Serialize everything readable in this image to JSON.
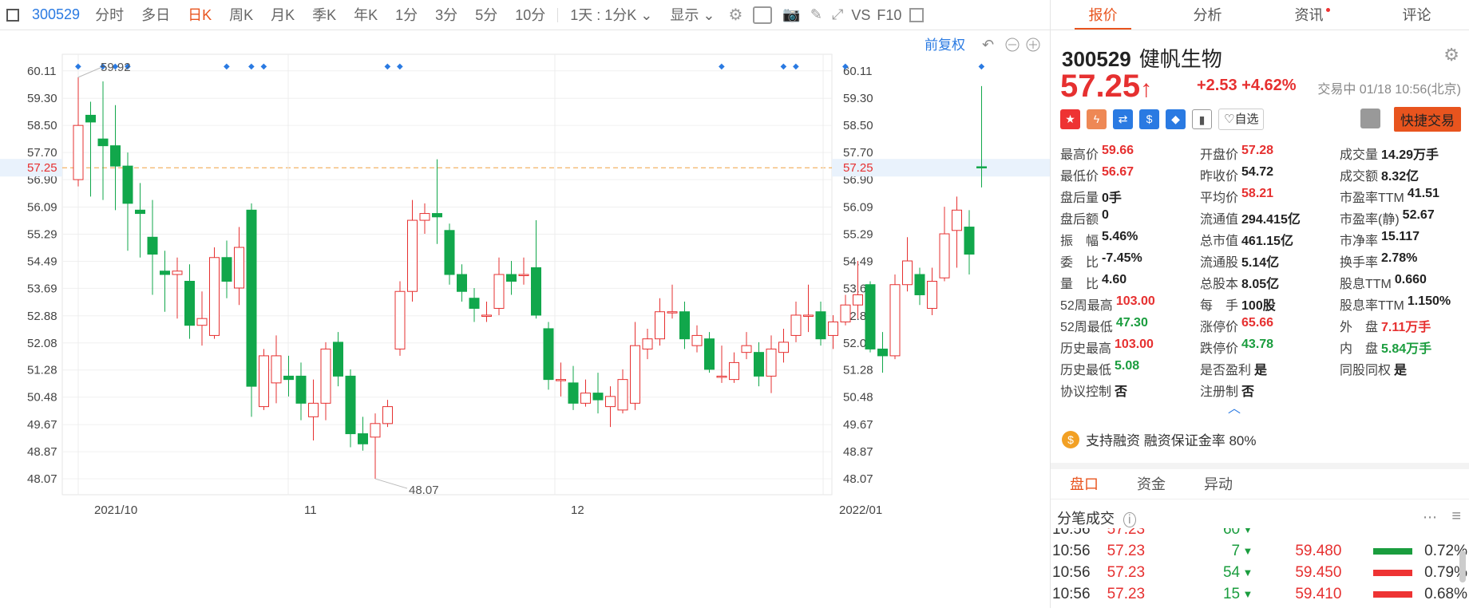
{
  "toolbar": {
    "items": [
      "300529",
      "分时",
      "多日",
      "日K",
      "周K",
      "月K",
      "季K",
      "年K",
      "1分",
      "3分",
      "5分",
      "10分",
      "1天 : 1分K",
      "显示",
      "VS",
      "F10"
    ],
    "active_index": 3
  },
  "chart": {
    "restore_label": "前复权",
    "high_label": "59.92",
    "low_label": "48.07",
    "current_label": "57.25",
    "y_ticks": [
      "60.11",
      "59.30",
      "58.50",
      "57.70",
      "57.25",
      "56.90",
      "56.09",
      "55.29",
      "54.49",
      "53.69",
      "52.88",
      "52.08",
      "51.28",
      "50.48",
      "49.67",
      "48.87",
      "48.07"
    ],
    "x_labels": [
      "2021/10",
      "11",
      "12",
      "2022/01"
    ]
  },
  "chart_data": {
    "type": "candlestick",
    "x_labels": [
      "2021/10",
      "11",
      "12",
      "2022/01"
    ],
    "ylim": [
      47.6,
      60.6
    ],
    "current_price": 57.25,
    "candles": [
      {
        "o": 56.9,
        "c": 58.5,
        "h": 59.92,
        "l": 56.7
      },
      {
        "o": 58.8,
        "c": 58.6,
        "h": 59.2,
        "l": 56.4
      },
      {
        "o": 58.1,
        "c": 57.9,
        "h": 59.8,
        "l": 56.3
      },
      {
        "o": 57.9,
        "c": 57.3,
        "h": 59.1,
        "l": 56.0
      },
      {
        "o": 57.3,
        "c": 56.2,
        "h": 57.7,
        "l": 54.8
      },
      {
        "o": 56.0,
        "c": 55.9,
        "h": 56.8,
        "l": 54.6
      },
      {
        "o": 55.2,
        "c": 54.7,
        "h": 56.3,
        "l": 53.5
      },
      {
        "o": 54.2,
        "c": 54.1,
        "h": 54.8,
        "l": 53.0
      },
      {
        "o": 54.1,
        "c": 54.2,
        "h": 54.6,
        "l": 52.8
      },
      {
        "o": 53.9,
        "c": 52.6,
        "h": 54.4,
        "l": 52.2
      },
      {
        "o": 52.6,
        "c": 52.8,
        "h": 53.6,
        "l": 52.0
      },
      {
        "o": 52.3,
        "c": 54.6,
        "h": 54.9,
        "l": 52.2
      },
      {
        "o": 54.6,
        "c": 53.9,
        "h": 55.1,
        "l": 53.4
      },
      {
        "o": 53.7,
        "c": 54.9,
        "h": 55.5,
        "l": 53.2
      },
      {
        "o": 56.0,
        "c": 50.8,
        "h": 56.2,
        "l": 49.9
      },
      {
        "o": 50.2,
        "c": 51.7,
        "h": 51.9,
        "l": 50.1
      },
      {
        "o": 50.9,
        "c": 51.7,
        "h": 52.3,
        "l": 50.3
      },
      {
        "o": 51.1,
        "c": 51.0,
        "h": 51.7,
        "l": 50.5
      },
      {
        "o": 51.1,
        "c": 50.3,
        "h": 51.5,
        "l": 49.8
      },
      {
        "o": 49.9,
        "c": 50.3,
        "h": 51.0,
        "l": 49.2
      },
      {
        "o": 50.3,
        "c": 51.9,
        "h": 52.1,
        "l": 49.8
      },
      {
        "o": 52.1,
        "c": 51.1,
        "h": 52.4,
        "l": 50.8
      },
      {
        "o": 51.1,
        "c": 49.4,
        "h": 51.3,
        "l": 49.0
      },
      {
        "o": 49.4,
        "c": 49.1,
        "h": 49.9,
        "l": 48.9
      },
      {
        "o": 49.3,
        "c": 49.7,
        "h": 50.0,
        "l": 48.07
      },
      {
        "o": 49.7,
        "c": 50.2,
        "h": 50.4,
        "l": 49.6
      },
      {
        "o": 51.9,
        "c": 53.6,
        "h": 53.9,
        "l": 51.7
      },
      {
        "o": 53.6,
        "c": 55.7,
        "h": 56.3,
        "l": 53.3
      },
      {
        "o": 55.7,
        "c": 55.9,
        "h": 56.2,
        "l": 55.3
      },
      {
        "o": 55.9,
        "c": 55.8,
        "h": 57.5,
        "l": 55.0
      },
      {
        "o": 55.4,
        "c": 54.1,
        "h": 55.6,
        "l": 53.8
      },
      {
        "o": 54.1,
        "c": 53.6,
        "h": 54.4,
        "l": 53.3
      },
      {
        "o": 53.4,
        "c": 53.1,
        "h": 53.7,
        "l": 52.7
      },
      {
        "o": 52.9,
        "c": 52.9,
        "h": 53.3,
        "l": 52.7
      },
      {
        "o": 53.1,
        "c": 54.1,
        "h": 54.6,
        "l": 52.9
      },
      {
        "o": 54.1,
        "c": 53.9,
        "h": 54.5,
        "l": 53.5
      },
      {
        "o": 54.1,
        "c": 54.1,
        "h": 54.6,
        "l": 53.8
      },
      {
        "o": 54.3,
        "c": 52.9,
        "h": 55.7,
        "l": 52.8
      },
      {
        "o": 52.5,
        "c": 51.0,
        "h": 52.7,
        "l": 50.7
      },
      {
        "o": 51.0,
        "c": 51.0,
        "h": 51.5,
        "l": 50.5
      },
      {
        "o": 50.9,
        "c": 50.3,
        "h": 51.4,
        "l": 50.1
      },
      {
        "o": 50.3,
        "c": 50.6,
        "h": 51.0,
        "l": 50.2
      },
      {
        "o": 50.6,
        "c": 50.4,
        "h": 51.2,
        "l": 50.0
      },
      {
        "o": 50.2,
        "c": 50.5,
        "h": 50.8,
        "l": 49.6
      },
      {
        "o": 50.1,
        "c": 51.0,
        "h": 51.3,
        "l": 50.0
      },
      {
        "o": 50.3,
        "c": 52.0,
        "h": 52.7,
        "l": 50.1
      },
      {
        "o": 51.9,
        "c": 52.2,
        "h": 52.5,
        "l": 51.6
      },
      {
        "o": 52.2,
        "c": 53.0,
        "h": 53.4,
        "l": 52.0
      },
      {
        "o": 53.0,
        "c": 53.0,
        "h": 53.8,
        "l": 52.8
      },
      {
        "o": 53.0,
        "c": 52.2,
        "h": 53.3,
        "l": 51.9
      },
      {
        "o": 52.0,
        "c": 52.3,
        "h": 52.6,
        "l": 51.8
      },
      {
        "o": 52.2,
        "c": 51.3,
        "h": 52.4,
        "l": 51.2
      },
      {
        "o": 51.1,
        "c": 51.1,
        "h": 52.0,
        "l": 50.9
      },
      {
        "o": 51.0,
        "c": 51.5,
        "h": 51.8,
        "l": 50.9
      },
      {
        "o": 51.8,
        "c": 52.0,
        "h": 52.4,
        "l": 51.6
      },
      {
        "o": 51.8,
        "c": 51.1,
        "h": 52.1,
        "l": 50.8
      },
      {
        "o": 51.1,
        "c": 51.9,
        "h": 52.3,
        "l": 50.6
      },
      {
        "o": 51.8,
        "c": 52.1,
        "h": 52.5,
        "l": 51.5
      },
      {
        "o": 52.3,
        "c": 52.9,
        "h": 53.3,
        "l": 52.1
      },
      {
        "o": 52.9,
        "c": 52.9,
        "h": 53.8,
        "l": 52.4
      },
      {
        "o": 53.0,
        "c": 52.2,
        "h": 53.3,
        "l": 52.0
      },
      {
        "o": 52.3,
        "c": 52.7,
        "h": 52.9,
        "l": 51.9
      },
      {
        "o": 52.7,
        "c": 53.2,
        "h": 53.5,
        "l": 52.6
      },
      {
        "o": 53.2,
        "c": 53.5,
        "h": 54.5,
        "l": 52.8
      },
      {
        "o": 53.8,
        "c": 51.9,
        "h": 53.9,
        "l": 51.8
      },
      {
        "o": 51.9,
        "c": 51.7,
        "h": 52.4,
        "l": 51.2
      },
      {
        "o": 51.7,
        "c": 53.8,
        "h": 54.1,
        "l": 51.6
      },
      {
        "o": 53.8,
        "c": 54.5,
        "h": 55.2,
        "l": 53.6
      },
      {
        "o": 54.1,
        "c": 53.5,
        "h": 54.3,
        "l": 53.2
      },
      {
        "o": 53.1,
        "c": 53.9,
        "h": 54.3,
        "l": 52.9
      },
      {
        "o": 54.0,
        "c": 55.3,
        "h": 56.1,
        "l": 53.9
      },
      {
        "o": 55.4,
        "c": 56.0,
        "h": 56.4,
        "l": 54.3
      },
      {
        "o": 55.5,
        "c": 54.7,
        "h": 56.0,
        "l": 54.1
      },
      {
        "o": 57.28,
        "c": 57.25,
        "h": 59.66,
        "l": 56.67
      }
    ]
  },
  "right": {
    "tabs": [
      "报价",
      "分析",
      "资讯",
      "评论"
    ],
    "code": "300529",
    "name": "健帆生物",
    "price": "57.25",
    "arrow": "↑",
    "change": "+2.53",
    "change_pct": "+4.62%",
    "status": "交易中 01/18 10:56(北京)",
    "watch_label": "♡自选",
    "quick_trade": "快捷交易",
    "stats": [
      [
        {
          "l": "最高价",
          "v": "59.66",
          "c": "red"
        },
        {
          "l": "开盘价",
          "v": "57.28",
          "c": "red"
        },
        {
          "l": "成交量",
          "v": "14.29万手",
          "c": "blk"
        }
      ],
      [
        {
          "l": "最低价",
          "v": "56.67",
          "c": "red"
        },
        {
          "l": "昨收价",
          "v": "54.72",
          "c": "blk"
        },
        {
          "l": "成交额",
          "v": "8.32亿",
          "c": "blk"
        }
      ],
      [
        {
          "l": "盘后量",
          "v": "0手",
          "c": "blk"
        },
        {
          "l": "平均价",
          "v": "58.21",
          "c": "red"
        },
        {
          "l": "市盈率TTM",
          "v": "41.51",
          "c": "blk"
        }
      ],
      [
        {
          "l": "盘后额",
          "v": "0",
          "c": "blk"
        },
        {
          "l": "流通值",
          "v": "294.415亿",
          "c": "blk"
        },
        {
          "l": "市盈率(静)",
          "v": "52.67",
          "c": "blk"
        }
      ],
      [
        {
          "l": "振　幅",
          "v": "5.46%",
          "c": "blk"
        },
        {
          "l": "总市值",
          "v": "461.15亿",
          "c": "blk"
        },
        {
          "l": "市净率",
          "v": "15.117",
          "c": "blk"
        }
      ],
      [
        {
          "l": "委　比",
          "v": "-7.45%",
          "c": "blk"
        },
        {
          "l": "流通股",
          "v": "5.14亿",
          "c": "blk"
        },
        {
          "l": "换手率",
          "v": "2.78%",
          "c": "blk"
        }
      ],
      [
        {
          "l": "量　比",
          "v": "4.60",
          "c": "blk"
        },
        {
          "l": "总股本",
          "v": "8.05亿",
          "c": "blk"
        },
        {
          "l": "股息TTM",
          "v": "0.660",
          "c": "blk"
        }
      ],
      [
        {
          "l": "52周最高",
          "v": "103.00",
          "c": "red"
        },
        {
          "l": "每　手",
          "v": "100股",
          "c": "blk"
        },
        {
          "l": "股息率TTM",
          "v": "1.150%",
          "c": "blk"
        }
      ],
      [
        {
          "l": "52周最低",
          "v": "47.30",
          "c": "green"
        },
        {
          "l": "涨停价",
          "v": "65.66",
          "c": "red"
        },
        {
          "l": "外　盘",
          "v": "7.11万手",
          "c": "red"
        }
      ],
      [
        {
          "l": "历史最高",
          "v": "103.00",
          "c": "red"
        },
        {
          "l": "跌停价",
          "v": "43.78",
          "c": "green"
        },
        {
          "l": "内　盘",
          "v": "5.84万手",
          "c": "green"
        }
      ],
      [
        {
          "l": "历史最低",
          "v": "5.08",
          "c": "green"
        },
        {
          "l": "是否盈利",
          "v": "是",
          "c": "blk"
        },
        {
          "l": "同股同权",
          "v": "是",
          "c": "blk"
        }
      ],
      [
        {
          "l": "协议控制",
          "v": "否",
          "c": "blk"
        },
        {
          "l": "注册制",
          "v": "否",
          "c": "blk"
        },
        {
          "l": "",
          "v": "",
          "c": "blk"
        }
      ]
    ],
    "margin_text": "支持融资 融资保证金率 80%",
    "subtabs": [
      "盘口",
      "资金",
      "异动"
    ],
    "ticks_title": "分笔成交",
    "ticks": [
      {
        "t": "10:56",
        "p": "57.23",
        "q": "60",
        "bp": "",
        "pct": ""
      },
      {
        "t": "10:56",
        "p": "57.23",
        "q": "7",
        "bp": "59.480",
        "pct": "0.72%"
      },
      {
        "t": "10:56",
        "p": "57.23",
        "q": "54",
        "bp": "59.450",
        "pct": "0.79%"
      },
      {
        "t": "10:56",
        "p": "57.23",
        "q": "15",
        "bp": "59.410",
        "pct": "0.68%"
      }
    ]
  }
}
